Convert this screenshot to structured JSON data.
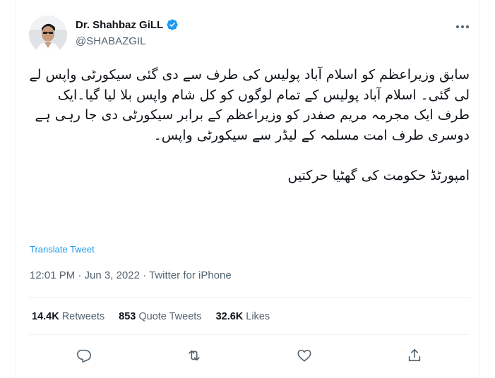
{
  "author": {
    "name": "Dr. Shahbaz GiLL",
    "handle": "@SHABAZGIL"
  },
  "tweet": {
    "text": "سابق وزیراعظم کو اسلام آباد پولیس کی طرف سے دی گئی سیکورٹی واپس لے لی گئی۔ اسلام آباد پولیس کے تمام لوگوں کو کل شام واپس بلا لیا گیا۔ایک طرف ایک مجرمہ مریم صفدر کو وزیراعظم کے برابر سیکورٹی دی جا رہی ہے دوسری طرف امت مسلمہ کے لیڈر سے سیکورٹی واپس۔\n\nامپورٹڈ حکومت کی گھٹیا حرکتیں",
    "translate_label": "Translate Tweet",
    "timestamp": "12:01 PM · Jun 3, 2022 · Twitter for iPhone"
  },
  "stats": [
    {
      "count": "14.4K",
      "label": "Retweets"
    },
    {
      "count": "853",
      "label": "Quote Tweets"
    },
    {
      "count": "32.6K",
      "label": "Likes"
    }
  ],
  "icons": {
    "verified": "verified-badge-icon",
    "more": "more-icon",
    "reply": "reply-icon",
    "retweet": "retweet-icon",
    "like": "heart-icon",
    "share": "share-icon"
  },
  "colors": {
    "accent": "#1d9bf0",
    "text": "#0f1419",
    "secondary": "#536471",
    "divider": "#eff3f4"
  }
}
